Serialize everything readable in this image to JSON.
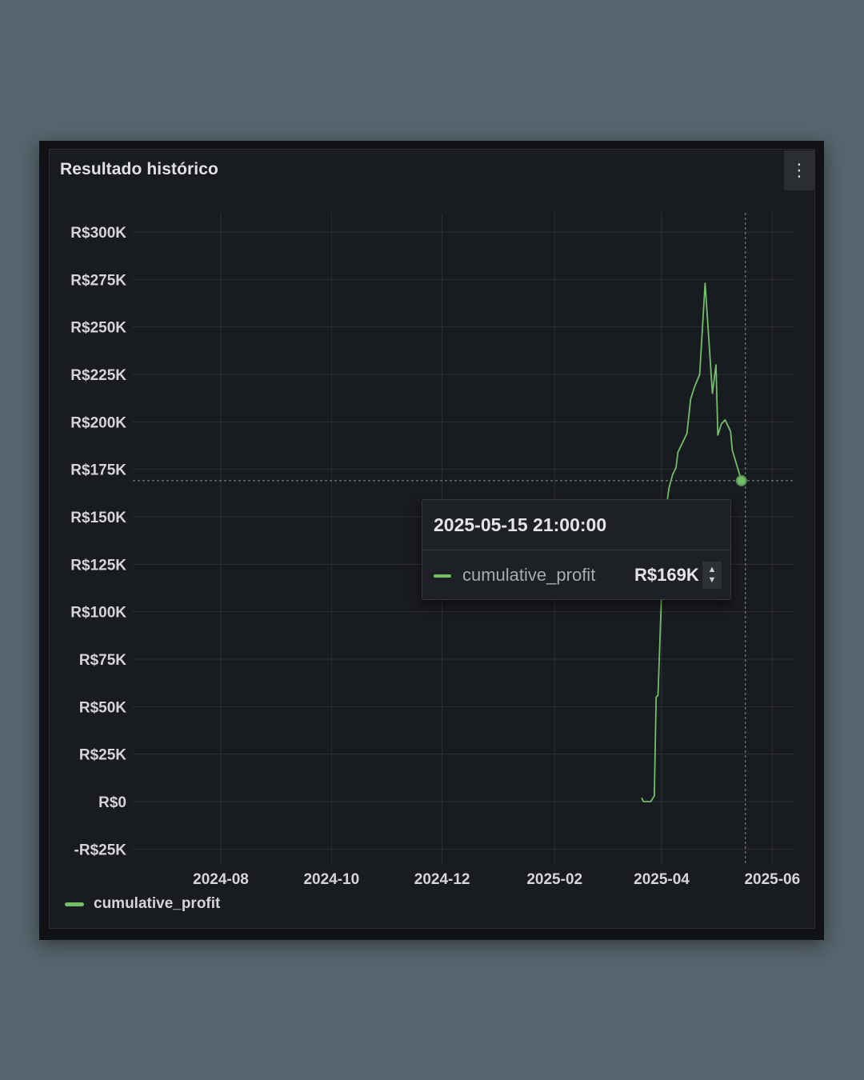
{
  "panel": {
    "title": "Resultado histórico",
    "menu_icon": "kebab-menu-icon"
  },
  "chart_data": {
    "type": "line",
    "title": "Resultado histórico",
    "xlabel": "",
    "ylabel": "",
    "x_ticks": [
      "2024-08",
      "2024-10",
      "2024-12",
      "2025-02",
      "2025-04",
      "2025-06"
    ],
    "y_ticks": [
      "R$300K",
      "R$275K",
      "R$250K",
      "R$225K",
      "R$200K",
      "R$175K",
      "R$150K",
      "R$125K",
      "R$100K",
      "R$75K",
      "R$50K",
      "R$25K",
      "R$0",
      "-R$25K"
    ],
    "ylim": [
      -25000,
      300000
    ],
    "grid": true,
    "legend_position": "bottom-left",
    "series": [
      {
        "name": "cumulative_profit",
        "color": "#73bf69",
        "points": [
          [
            "2025-03-21",
            2000
          ],
          [
            "2025-03-22",
            0
          ],
          [
            "2025-03-26",
            0
          ],
          [
            "2025-03-28",
            3000
          ],
          [
            "2025-03-29",
            55000
          ],
          [
            "2025-03-30",
            56000
          ],
          [
            "2025-04-01",
            110000
          ],
          [
            "2025-04-03",
            150000
          ],
          [
            "2025-04-05",
            165000
          ],
          [
            "2025-04-07",
            172000
          ],
          [
            "2025-04-09",
            176000
          ],
          [
            "2025-04-10",
            184000
          ],
          [
            "2025-04-13",
            190000
          ],
          [
            "2025-04-15",
            194000
          ],
          [
            "2025-04-17",
            212000
          ],
          [
            "2025-04-19",
            218000
          ],
          [
            "2025-04-22",
            225000
          ],
          [
            "2025-04-25",
            273000
          ],
          [
            "2025-04-29",
            215000
          ],
          [
            "2025-05-01",
            230000
          ],
          [
            "2025-05-02",
            193000
          ],
          [
            "2025-05-04",
            199000
          ],
          [
            "2025-05-06",
            201000
          ],
          [
            "2025-05-09",
            195000
          ],
          [
            "2025-05-10",
            185000
          ],
          [
            "2025-05-15",
            169000
          ]
        ]
      }
    ],
    "crosshair": {
      "time": "2025-05-15",
      "value": 169000
    }
  },
  "legend": {
    "items": [
      {
        "label": "cumulative_profit",
        "color": "#73bf69"
      }
    ]
  },
  "tooltip": {
    "time": "2025-05-15 21:00:00",
    "series": "cumulative_profit",
    "value": "R$169K",
    "stepper_up": "▲",
    "stepper_down": "▼"
  }
}
